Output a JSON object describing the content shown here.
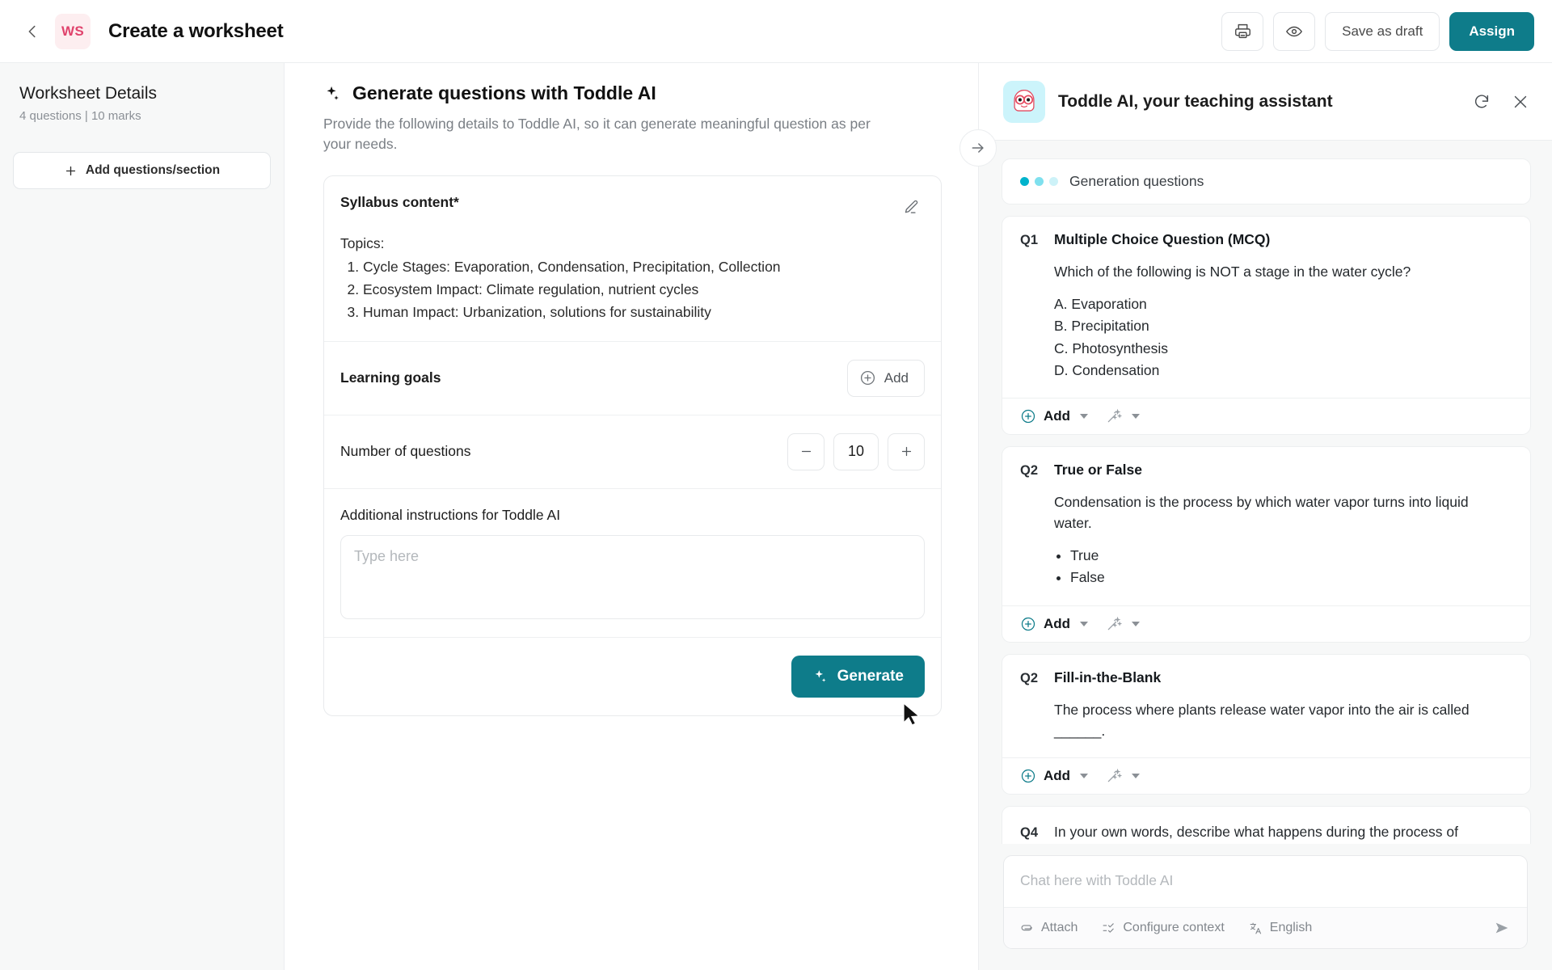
{
  "topbar": {
    "back_icon": "chevron-left-icon",
    "avatar_initials": "WS",
    "title": "Create a worksheet",
    "print_icon": "printer-icon",
    "preview_icon": "eye-icon",
    "save_draft_label": "Save as draft",
    "assign_label": "Assign",
    "accent_color": "#0e7c8a",
    "avatar_bg": "#fdeef0",
    "avatar_fg": "#e0436c"
  },
  "sidebar": {
    "title": "Worksheet Details",
    "subtitle": "4 questions | 10 marks",
    "add_button_label": "Add questions/section",
    "add_icon": "plus-icon"
  },
  "main": {
    "sparkle_icon": "sparkle-icon",
    "heading": "Generate questions with Toddle AI",
    "description": "Provide the following details to Toddle AI, so it can generate meaningful question as per your needs.",
    "syllabus": {
      "label": "Syllabus content*",
      "edit_icon": "pencil-icon",
      "topics_label": "Topics:",
      "topics": [
        "Cycle Stages: Evaporation, Condensation, Precipitation, Collection",
        "Ecosystem Impact: Climate regulation, nutrient cycles",
        "Human Impact: Urbanization, solutions for sustainability"
      ]
    },
    "learning_goals": {
      "label": "Learning goals",
      "add_label": "Add",
      "add_icon": "plus-circle-icon"
    },
    "number_of_questions": {
      "label": "Number of questions",
      "decrement_icon": "minus-icon",
      "value": "10",
      "increment_icon": "plus-icon"
    },
    "additional_instructions": {
      "label": "Additional instructions for Toddle AI",
      "placeholder": "Type here",
      "value": ""
    },
    "generate_label": "Generate",
    "generate_icon": "sparkle-icon",
    "cursor_icon": "mouse-pointer-icon"
  },
  "right_panel": {
    "collapse_icon": "arrow-right-icon",
    "avatar_icon": "toddle-bot-icon",
    "title": "Toddle AI, your teaching assistant",
    "refresh_icon": "refresh-icon",
    "close_icon": "close-icon",
    "status": {
      "text": "Generation questions",
      "dot_colors": [
        "#00b3cc",
        "#7fe0ee",
        "#cdf2f8"
      ]
    },
    "questions": [
      {
        "num": "Q1",
        "type": "Multiple Choice Question (MCQ)",
        "text": "Which of the following is NOT a stage in the water cycle?",
        "options": [
          "A. Evaporation",
          "B. Precipitation",
          "C. Photosynthesis",
          "D. Condensation"
        ],
        "bullets": [],
        "has_footer": true,
        "add_label": "Add",
        "add_icon": "plus-circle-icon",
        "wand_icon": "magic-wand-icon"
      },
      {
        "num": "Q2",
        "type": "True or False",
        "text": "Condensation is the process by which water vapor turns into liquid water.",
        "options": [],
        "bullets": [
          "True",
          "False"
        ],
        "has_footer": true,
        "add_label": "Add",
        "add_icon": "plus-circle-icon",
        "wand_icon": "magic-wand-icon"
      },
      {
        "num": "Q2",
        "type": "Fill-in-the-Blank",
        "text": "The process where plants release water vapor into the air is called ______.",
        "options": [],
        "bullets": [],
        "has_footer": true,
        "add_label": "Add",
        "add_icon": "plus-circle-icon",
        "wand_icon": "magic-wand-icon"
      }
    ],
    "plain_question": {
      "num": "Q4",
      "text": "In your own words, describe what happens during the process of precipitation."
    },
    "chat": {
      "placeholder": "Chat here with Toddle AI",
      "value": "",
      "attach_label": "Attach",
      "attach_icon": "paperclip-icon",
      "configure_label": "Configure context",
      "configure_icon": "checklist-icon",
      "language_label": "English",
      "language_icon": "translate-icon",
      "send_icon": "send-icon"
    }
  }
}
